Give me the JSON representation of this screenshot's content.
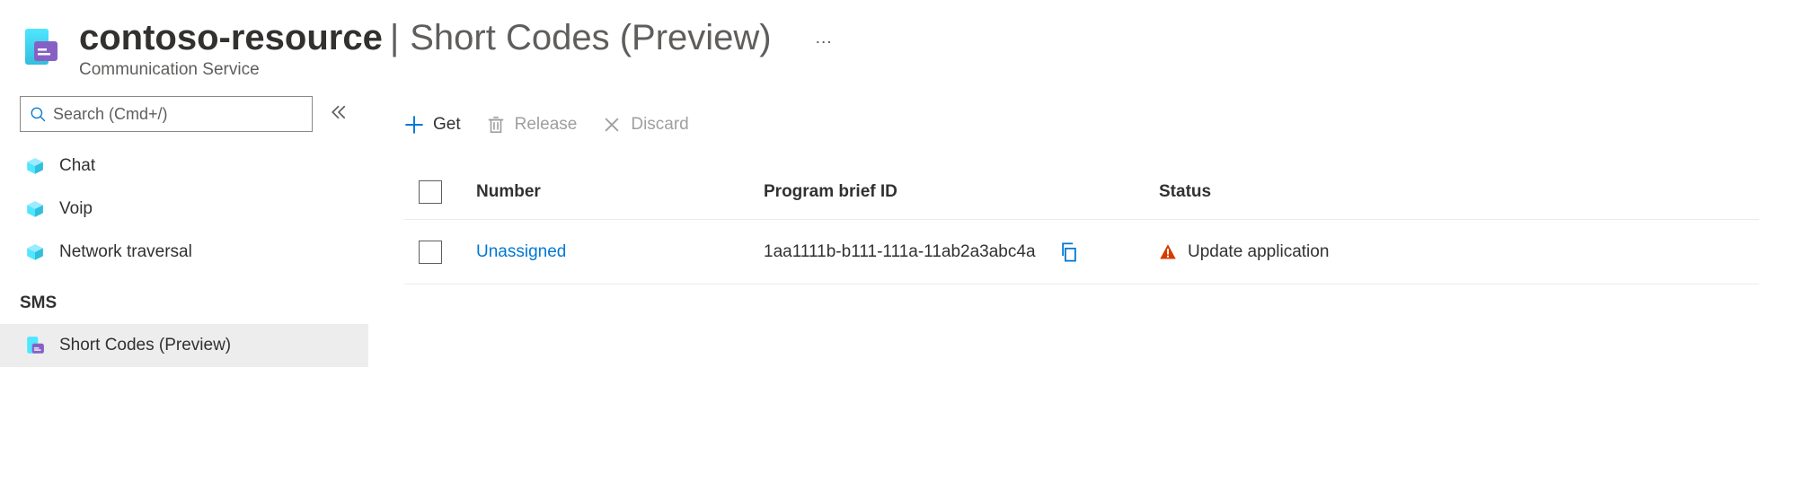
{
  "header": {
    "resource_name": "contoso-resource",
    "separator": "|",
    "page_title": "Short Codes (Preview)",
    "subtitle": "Communication Service",
    "more_label": "…"
  },
  "sidebar": {
    "search_placeholder": "Search (Cmd+/)",
    "items": [
      {
        "label": "Chat"
      },
      {
        "label": "Voip"
      },
      {
        "label": "Network traversal"
      }
    ],
    "section_title": "SMS",
    "sms_items": [
      {
        "label": "Short Codes (Preview)"
      }
    ]
  },
  "toolbar": {
    "get": "Get",
    "release": "Release",
    "discard": "Discard"
  },
  "table": {
    "columns": {
      "number": "Number",
      "program_brief": "Program brief ID",
      "status": "Status"
    },
    "rows": [
      {
        "number": "Unassigned",
        "program_brief_id": "1aa1111b-b111-111a-11ab2a3abc4a",
        "status": "Update application"
      }
    ]
  }
}
